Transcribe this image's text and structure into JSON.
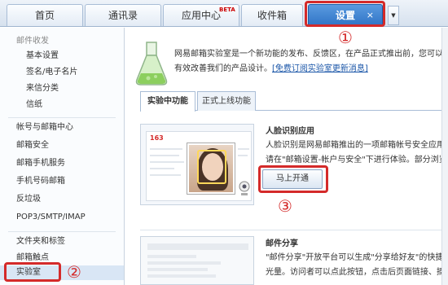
{
  "top_tabs": [
    {
      "label": "首页",
      "active": false
    },
    {
      "label": "通讯录",
      "active": false
    },
    {
      "label": "应用中心",
      "badge": "BETA",
      "active": false
    },
    {
      "label": "收件箱",
      "active": false
    },
    {
      "label": "设置",
      "active": true,
      "close": "×"
    }
  ],
  "tab_dropdown_icon": "▼",
  "annotations": {
    "one": "①",
    "two": "②",
    "three": "③"
  },
  "sidebar": {
    "group1": "邮件收发",
    "items1": [
      "基本设置",
      "签名/电子名片",
      "来信分类",
      "信纸"
    ],
    "items2": [
      "帐号与邮箱中心",
      "邮箱安全",
      "邮箱手机服务",
      "手机号码邮箱",
      "反垃圾",
      "POP3/SMTP/IMAP"
    ],
    "items3": [
      "文件夹和标签",
      "邮箱触点",
      "实验室"
    ]
  },
  "main": {
    "intro_lines": [
      "网易邮箱实验室是一个新功能的发布、反馈区，在产品正式推出前，您可以在这里优先",
      "有效改善我们的产品设计。"
    ],
    "intro_link": "[免费订阅实验室更新消息]",
    "tabs": [
      "实验中功能",
      "正式上线功能"
    ],
    "feature1": {
      "logo": "163",
      "title": "人脸识别应用",
      "desc_lines": [
        "人脸识别是网易邮箱推出的一项邮箱帐号安全应用。该应",
        "请在\"邮箱设置-帐户与安全\"下进行体验。部分浏览器兼"
      ],
      "button": "马上开通"
    },
    "feature2": {
      "title": "邮件分享",
      "desc_lines": [
        "\"邮件分享\"开放平台可以生成\"分享给好友\"的快捷方式，",
        "光量。访问者可以点此按钮，点击后页面链接、摘要等内"
      ]
    }
  },
  "colors": {
    "accent": "#2f73c5",
    "highlight": "#d42a2a",
    "link": "#1a56a8"
  }
}
